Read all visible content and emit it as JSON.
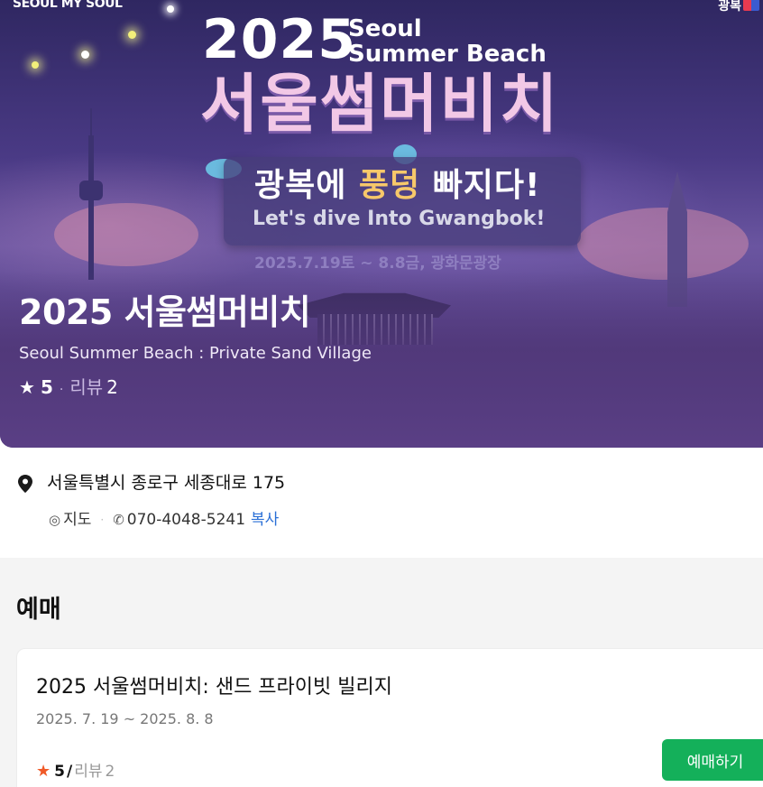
{
  "hero": {
    "brand_left": "SEOUL MY SOUL",
    "brand_right": "광복",
    "poster": {
      "year": "2025",
      "subtitle_line1": "Seoul",
      "subtitle_line2": "Summer Beach",
      "korean_title": "서울썸머비치",
      "slogan_pre": "광복에 ",
      "slogan_highlight": "풍덩",
      "slogan_post": " 빠지다!",
      "slogan_en": "Let's dive Into Gwangbok!",
      "date_line": "2025.7.19토 ~ 8.8금, 광화문광장"
    },
    "title": "2025 서울썸머비치",
    "subtitle": "Seoul Summer Beach : Private Sand Village",
    "rating": {
      "star_icon": "★",
      "score": "5",
      "separator": "·",
      "review_label": "리뷰",
      "review_count": "2"
    }
  },
  "location": {
    "address": "서울특별시 종로구 세종대로 175",
    "map_icon": "◎",
    "map_label": "지도",
    "separator": "·",
    "phone_icon": "✆",
    "phone": "070-4048-5241",
    "copy_label": "복사"
  },
  "booking": {
    "heading": "예매",
    "card": {
      "title": "2025 서울썸머비치: 샌드 프라이빗 빌리지",
      "dates": "2025. 7. 19 ~ 2025. 8. 8",
      "star_icon": "★",
      "score": "5",
      "slash": "/",
      "review_label": "리뷰",
      "review_count": "2",
      "button_label": "예매하기",
      "button_color": "#14b05a",
      "star_color": "#f05a28"
    }
  }
}
